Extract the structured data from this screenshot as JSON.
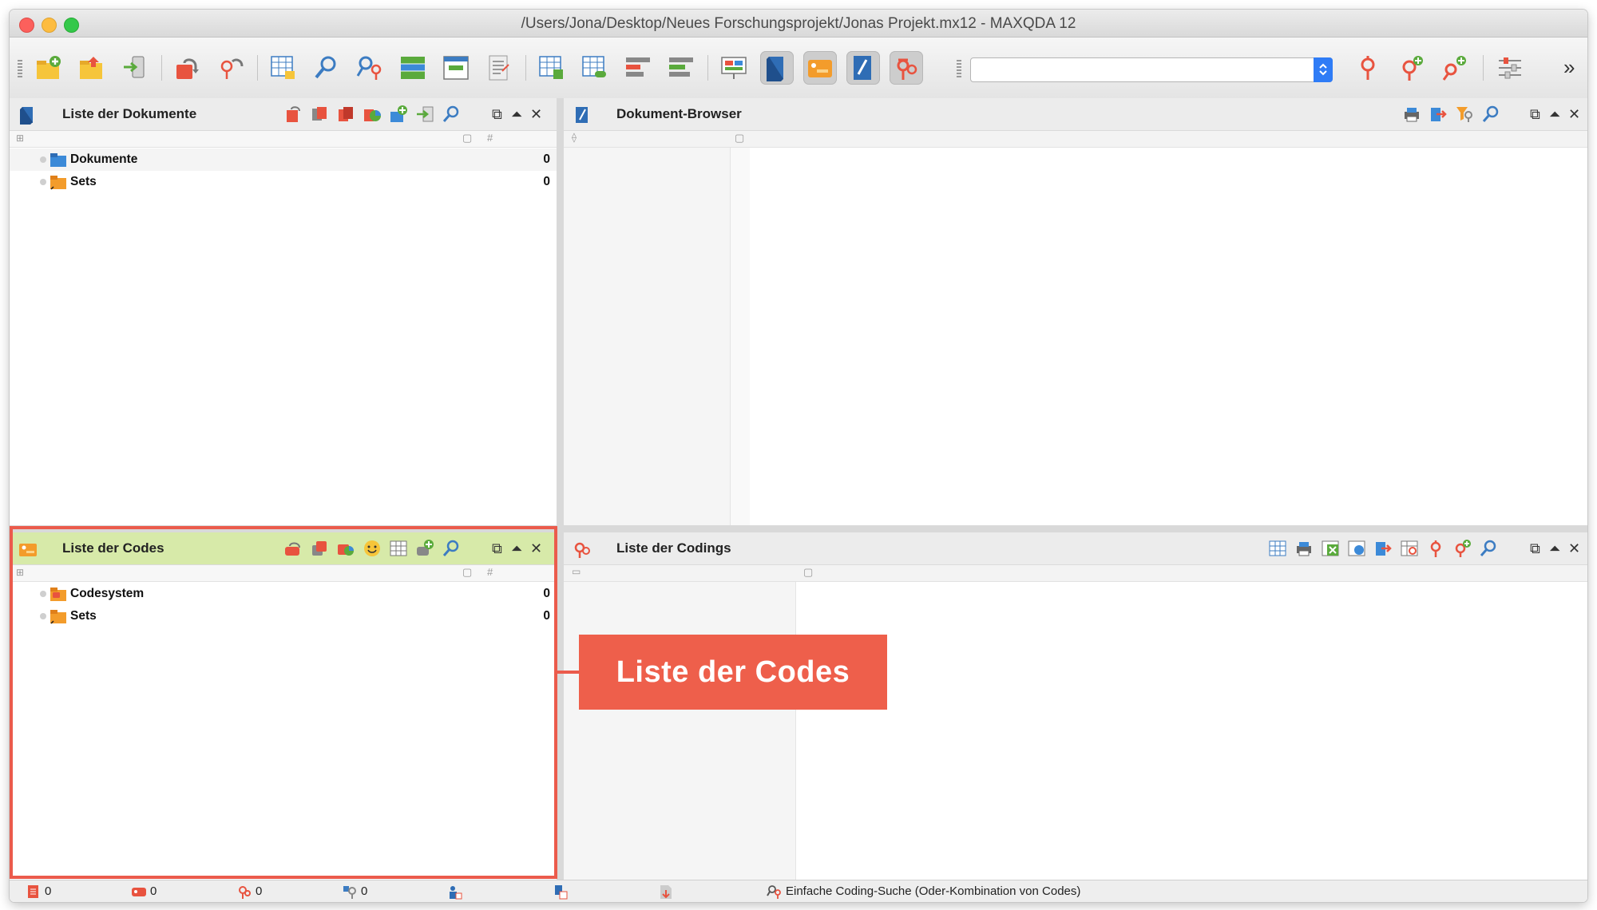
{
  "window": {
    "title": "/Users/Jona/Desktop/Neues Forschungsprojekt/Jonas Projekt.mx12 - MAXQDA 12"
  },
  "toolbar": {
    "search_value": "",
    "more_label": "»"
  },
  "panels": {
    "documents": {
      "title": "Liste der Dokumente",
      "items": [
        {
          "label": "Dokumente",
          "count": "0"
        },
        {
          "label": "Sets",
          "count": "0"
        }
      ]
    },
    "browser": {
      "title": "Dokument-Browser"
    },
    "codes": {
      "title": "Liste der Codes",
      "items": [
        {
          "label": "Codesystem",
          "count": "0"
        },
        {
          "label": "Sets",
          "count": "0"
        }
      ]
    },
    "codings": {
      "title": "Liste der Codings"
    }
  },
  "callout": {
    "label": "Liste der Codes"
  },
  "statusbar": {
    "documents_count": "0",
    "codes_count": "0",
    "codings_count": "0",
    "memos_count": "0",
    "search_mode": "Einfache Coding-Suche (Oder-Kombination von Codes)"
  },
  "colors": {
    "highlight": "#eb5b4c",
    "active_panel_header": "#d7eaa9",
    "folder_blue": "#3c8ad8",
    "folder_orange": "#f39c2b",
    "toolbar_red": "#e8533f",
    "toolbar_green": "#5aaa3c"
  }
}
